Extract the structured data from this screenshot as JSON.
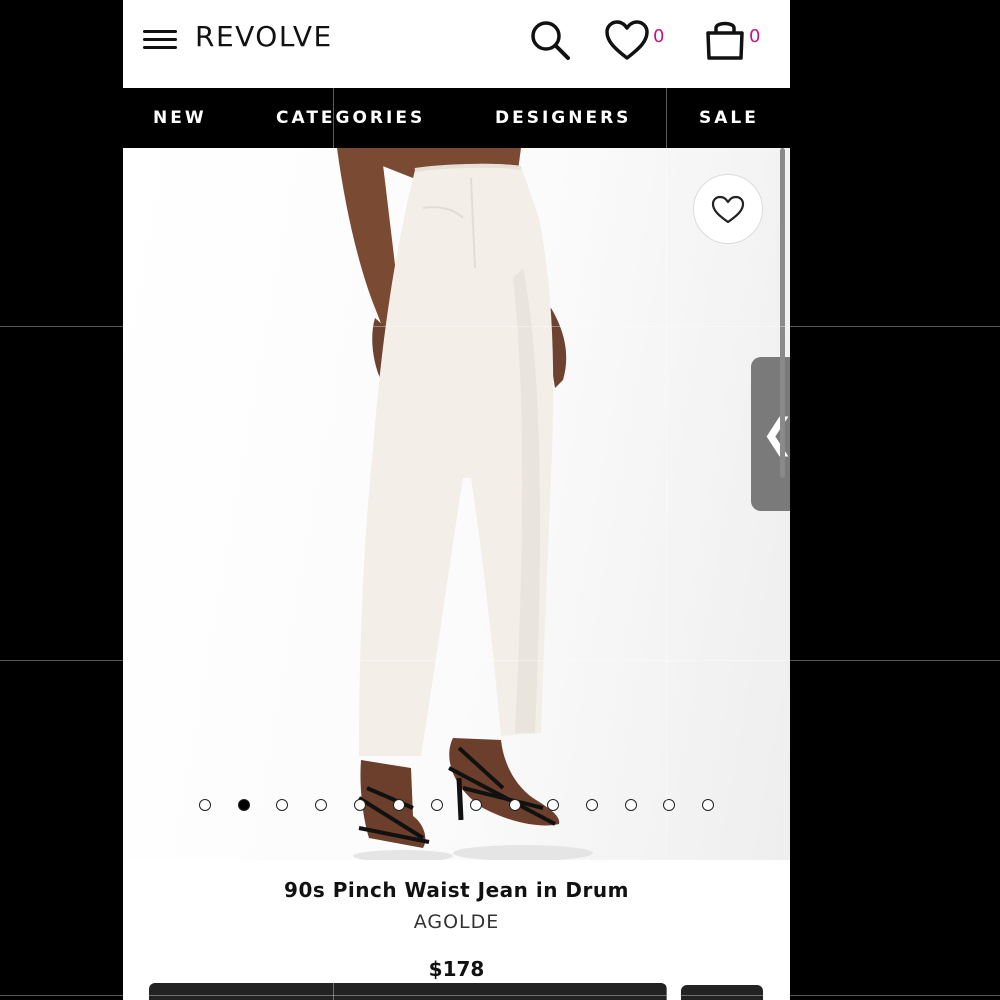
{
  "header": {
    "brand": "REVOLVE",
    "wishlist_count": "0",
    "cart_count": "0"
  },
  "nav": {
    "items": [
      "NEW",
      "CATEGORIES",
      "DESIGNERS",
      "SALE"
    ]
  },
  "product": {
    "title": "90s Pinch Waist Jean in Drum",
    "brand": "AGOLDE",
    "price": "$178",
    "image_count": 14,
    "active_image_index": 1
  },
  "side_tab": {
    "glyph": "❮"
  },
  "colors": {
    "accent_count": "#c2187c",
    "nav_bg": "#000000",
    "side_tab": "#7a7a7a"
  },
  "icons": [
    "menu-icon",
    "search-icon",
    "heart-icon",
    "bag-icon",
    "chevron-left-icon"
  ]
}
